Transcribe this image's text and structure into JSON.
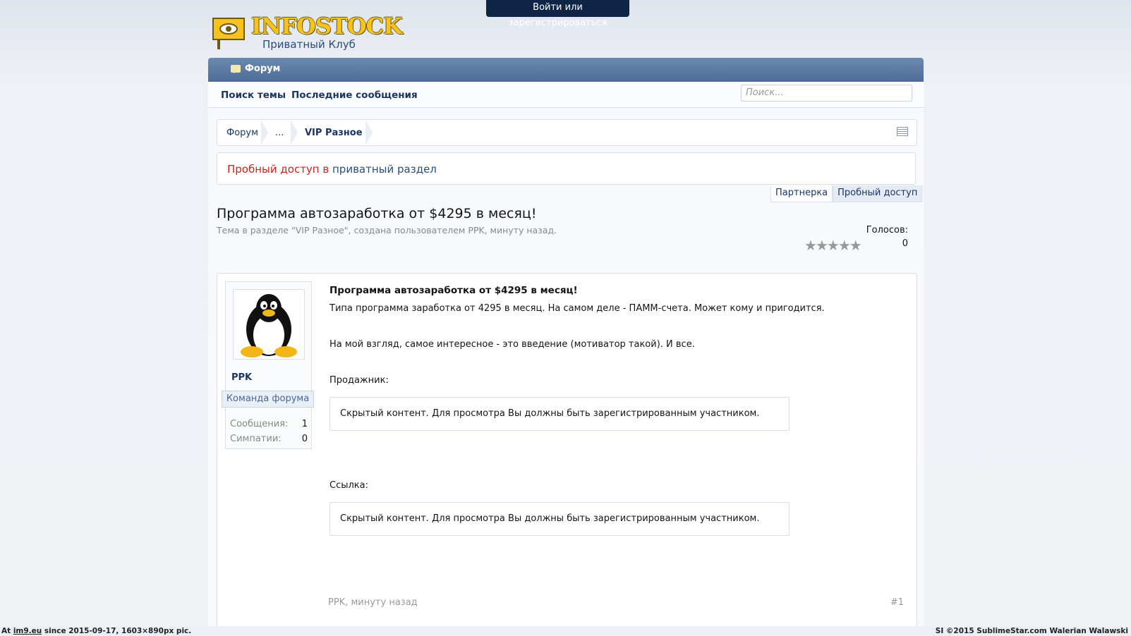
{
  "header": {
    "login_label": "Войти или зарегистрироваться",
    "logo_text": "INFOSTOCK",
    "logo_sub": "Приватный Клуб"
  },
  "nav": {
    "tab_label": "Форум",
    "sub_links": [
      "Поиск темы",
      "Последние сообщения"
    ],
    "search_placeholder": "Поиск..."
  },
  "breadcrumb": {
    "items": [
      "Форум",
      "...",
      "VIP Разное"
    ]
  },
  "notice": {
    "part1": "Пробный доступ в",
    "part2": " приватный раздел"
  },
  "tabs": [
    "Партнерка",
    "Пробный доступ"
  ],
  "thread": {
    "title": "Программа автозаработка от $4295 в месяц!",
    "meta": "Тема в разделе \"VIP Разное\", создана пользователем PPK, минуту назад.",
    "votes_label": "Голосов:",
    "votes_count": "0",
    "rating": 0
  },
  "post": {
    "username": "PPK",
    "role": "Команда форума",
    "stats": [
      {
        "label": "Сообщения:",
        "value": "1"
      },
      {
        "label": "Симпатии:",
        "value": "0"
      }
    ],
    "title": "Программа автозаработка от $4295 в месяц!",
    "line1": "Типа программа заработка от 4295 в месяц. На самом деле - ПАММ-счета. Может кому и пригодится.",
    "line2": "На мой взгляд, самое интересное - это введение (мотиватор такой). И все.",
    "seller_label": "Продажник:",
    "hidden_text": "Скрытый контент. Для просмотра Вы должны быть зарегистрированным участником.",
    "link_label": "Ссылка:",
    "footer": "PPK, минуту назад",
    "number": "#1"
  },
  "watermark": {
    "left_prefix": "At ",
    "left_site": "im9.eu",
    "left_rest": " since 2015-09-17, 1603×890px pic.",
    "right": "SI ©2015 SublimeStar.com Walerian Walawski"
  },
  "colors": {
    "accent": "#4d6c96",
    "link": "#1b3560",
    "notice_red": "#d42020"
  }
}
